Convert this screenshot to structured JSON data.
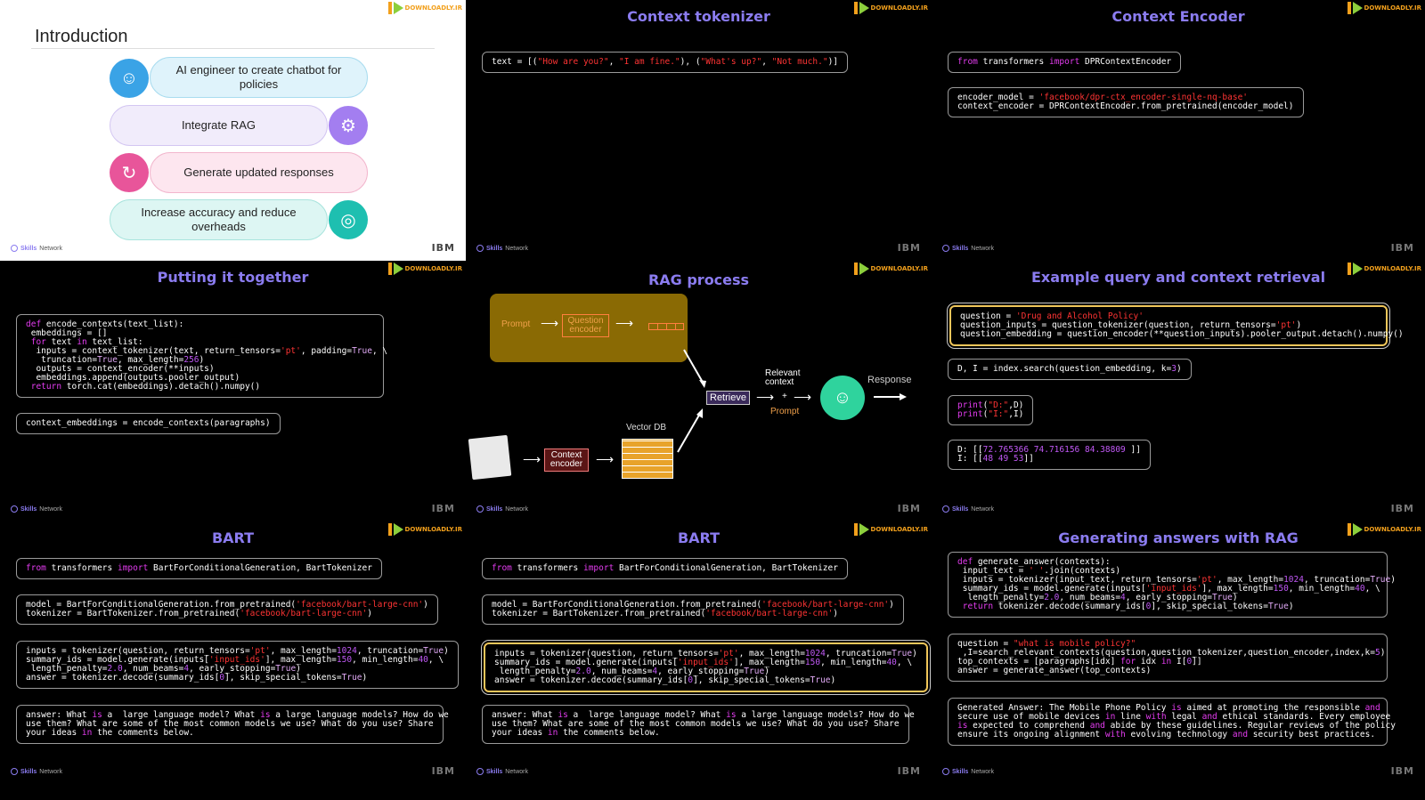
{
  "logo": {
    "text": "DOWNLOADLY.IR"
  },
  "footer": {
    "brand_bold": "Skills",
    "brand_rest": " Network",
    "ibm": "IBM"
  },
  "slides": {
    "intro": {
      "title": "Introduction",
      "items": [
        {
          "label": "AI engineer to create chatbot for policies",
          "icon": "chatbot-icon",
          "color": "#3aa3e6"
        },
        {
          "label": "Integrate RAG",
          "icon": "integration-icon",
          "color": "#a37ef0"
        },
        {
          "label": "Generate updated responses",
          "icon": "refresh-icon",
          "color": "#e8559a"
        },
        {
          "label": "Increase accuracy and reduce overheads",
          "icon": "accuracy-icon",
          "color": "#1ebfb0"
        }
      ]
    },
    "tokenizer": {
      "title": "Context tokenizer"
    },
    "encoder": {
      "title": "Context Encoder"
    },
    "together": {
      "title": "Putting it together"
    },
    "rag": {
      "title": "RAG process",
      "prompt": "Prompt",
      "question_encoder": "Question encoder",
      "retrieve": "Retrieve",
      "relevant_context": "Relevant context",
      "plus": "+",
      "prompt2": "Prompt",
      "response": "Response",
      "vector_db": "Vector DB",
      "context_encoder": "Context encoder"
    },
    "query": {
      "title": "Example query and context retrieval"
    },
    "bart1": {
      "title": "BART"
    },
    "bart2": {
      "title": "BART"
    },
    "generating": {
      "title": "Generating answers with RAG"
    }
  }
}
